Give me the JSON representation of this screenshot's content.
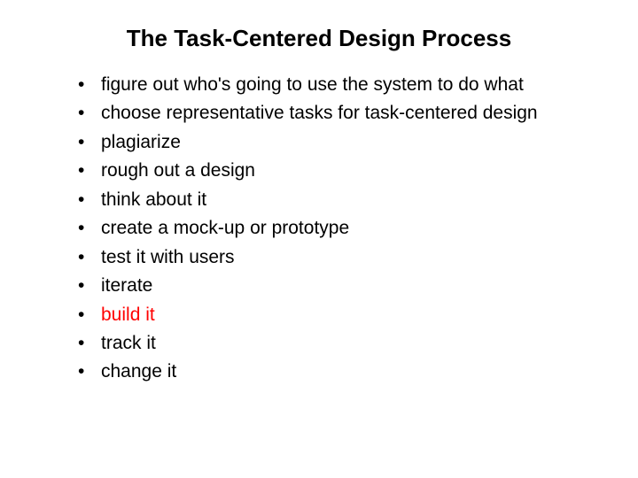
{
  "title": "The Task-Centered Design Process",
  "bullets": [
    {
      "text": "figure out who's going to use the system to do what",
      "accent": false
    },
    {
      "text": "choose representative tasks for task-centered design",
      "accent": false
    },
    {
      "text": "plagiarize",
      "accent": false
    },
    {
      "text": "rough out a design",
      "accent": false
    },
    {
      "text": "think about it",
      "accent": false
    },
    {
      "text": "create a mock-up or prototype",
      "accent": false
    },
    {
      "text": "test it with users",
      "accent": false
    },
    {
      "text": "iterate",
      "accent": false
    },
    {
      "text": "build it",
      "accent": true
    },
    {
      "text": "track it",
      "accent": false
    },
    {
      "text": "change it",
      "accent": false
    }
  ]
}
